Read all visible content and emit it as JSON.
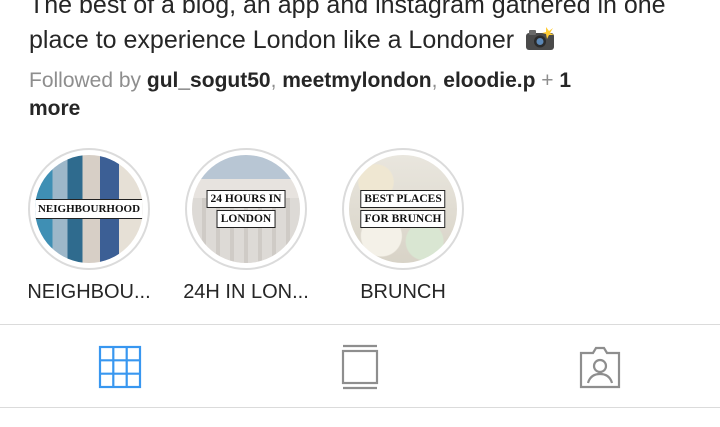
{
  "bio": {
    "text": "The best of a blog, an app and instagram gathered in one place to experience London like a Londoner",
    "emoji_icon": "camera-with-flash-icon"
  },
  "followed_by": {
    "prefix": "Followed by ",
    "users": [
      "gul_sogut50",
      "meetmylondon",
      "eloodie.p"
    ],
    "separator": ", ",
    "more_prefix": " + ",
    "more_count": "1",
    "more_label": " more"
  },
  "highlights": [
    {
      "title": "NEIGHBOU...",
      "cover_text": [
        "NEIGHBOURHOOD"
      ]
    },
    {
      "title": "24H IN LON...",
      "cover_text": [
        "24 HOURS IN",
        "LONDON"
      ]
    },
    {
      "title": "BRUNCH",
      "cover_text": [
        "BEST PLACES",
        "FOR BRUNCH"
      ]
    }
  ],
  "tabs": [
    {
      "name": "grid-view",
      "icon": "grid-icon",
      "active": true
    },
    {
      "name": "feed-view",
      "icon": "feed-icon",
      "active": false
    },
    {
      "name": "tagged-view",
      "icon": "tagged-person-icon",
      "active": false
    }
  ],
  "colors": {
    "active_tab": "#3897f0",
    "inactive_tab": "#8e8e8e",
    "text": "#262626",
    "muted": "#8e8e8e"
  }
}
